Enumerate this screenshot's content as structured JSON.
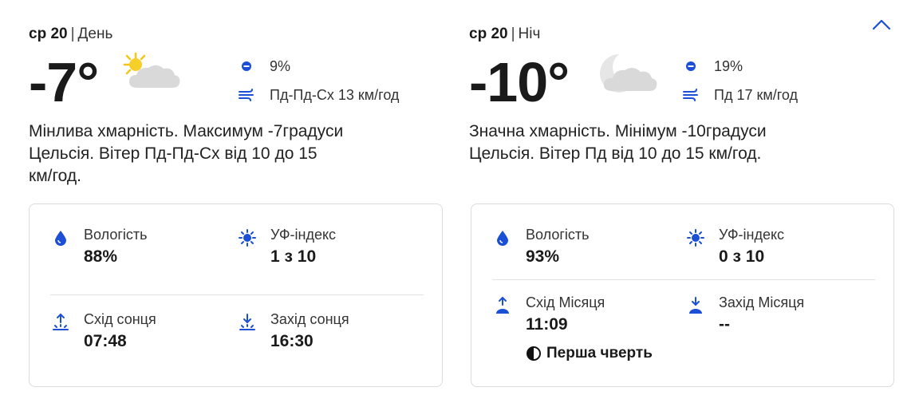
{
  "colors": {
    "accent": "#1a4fd6",
    "text": "#1a1a1a",
    "border": "#dcdcdc"
  },
  "day": {
    "date": "ср 20",
    "separator": "|",
    "part": "День",
    "temp": "-7°",
    "weather_icon": "sun-cloud-icon",
    "precip": "9%",
    "wind": "Пд-Пд-Сх 13 км/год",
    "desc_line1": "Мінлива хмарність. Максимум -7градуси",
    "desc_line2": "Цельсія. Вітер Пд-Пд-Сх від 10 до 15",
    "desc_line3": "км/год.",
    "humidity_label": "Вологість",
    "humidity": "88%",
    "uv_label": "УФ-індекс",
    "uv": "1 з 10",
    "rise_label": "Схід сонця",
    "rise": "07:48",
    "set_label": "Захід сонця",
    "set": "16:30"
  },
  "night": {
    "date": "ср 20",
    "separator": "|",
    "part": "Ніч",
    "temp": "-10°",
    "weather_icon": "moon-cloud-icon",
    "precip": "19%",
    "wind": "Пд 17 км/год",
    "desc_line1": "Значна хмарність. Мінімум -10градуси",
    "desc_line2": "Цельсія. Вітер Пд від 10 до 15 км/год.",
    "humidity_label": "Вологість",
    "humidity": "93%",
    "uv_label": "УФ-індекс",
    "uv": "0 з 10",
    "rise_label": "Схід Місяця",
    "rise": "11:09",
    "set_label": "Захід Місяця",
    "set": "--",
    "moon_phase": "Перша чверть"
  }
}
